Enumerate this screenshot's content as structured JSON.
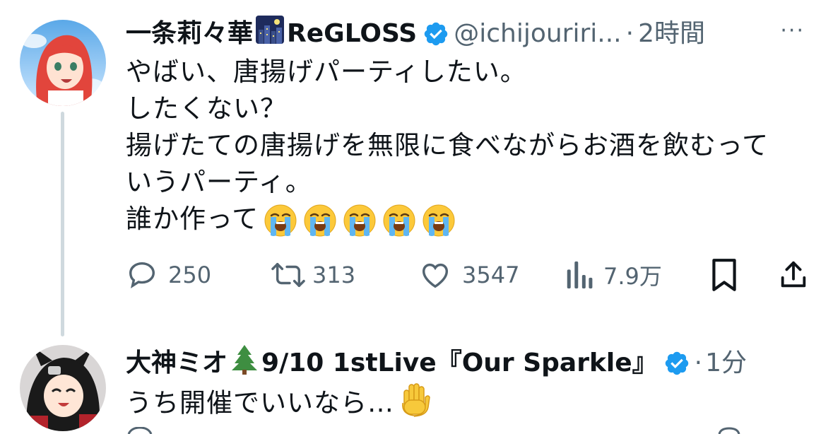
{
  "tweet1": {
    "display_name": "一条莉々華",
    "group_label": "ReGLOSS",
    "handle": "@ichijouriri...",
    "dot": "·",
    "time": "2時間",
    "more": "···",
    "lines": [
      "やばい、唐揚げパーティしたい。",
      "したくない？",
      "揚げたての唐揚げを無限に食べながらお酒を飲むって",
      "いうパーティ。",
      "誰か作って"
    ],
    "emoji_count": "5",
    "replies": "250",
    "reposts": "313",
    "likes": "3547",
    "views": "7.9万",
    "icons": [
      "reply-icon",
      "repost-icon",
      "like-icon",
      "views-icon",
      "bookmark-icon",
      "share-icon"
    ]
  },
  "tweet2": {
    "display_name_pre": "大神ミオ",
    "display_name_post": "9/10 1stLive『Our Sparkle』",
    "dot": "·",
    "time": "1分",
    "text": "うち開催でいいなら…"
  },
  "colors": {
    "text": "#0f1419",
    "secondary": "#536471",
    "verified": "#1d9bf0",
    "thread_line": "#cfd9de"
  }
}
